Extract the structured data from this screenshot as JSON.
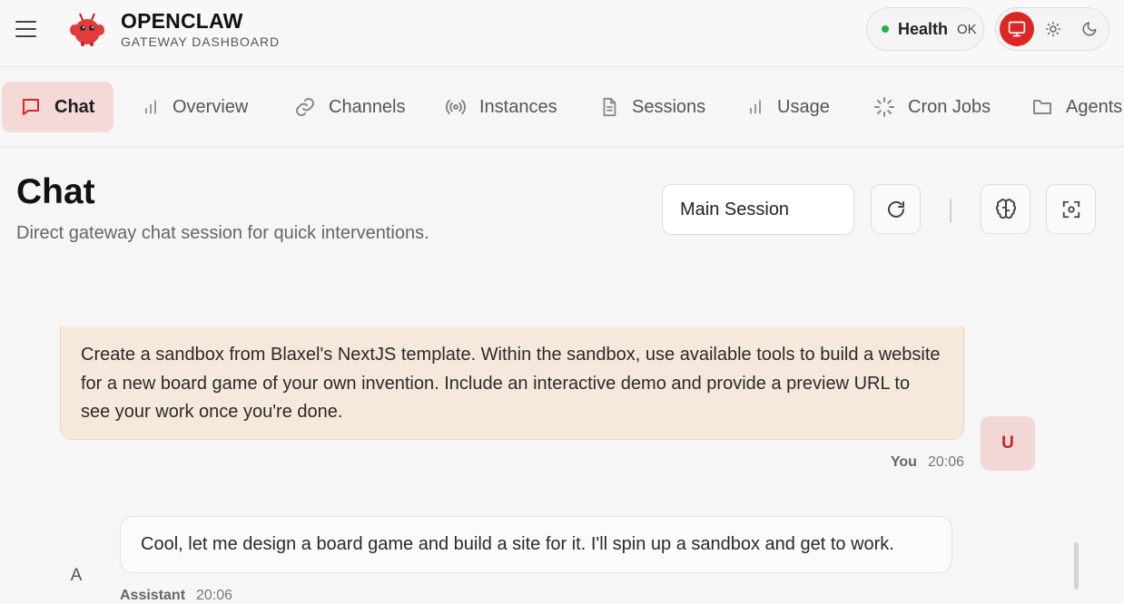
{
  "header": {
    "brand_title": "OPENCLAW",
    "brand_subtitle": "GATEWAY DASHBOARD",
    "health": {
      "label": "Health",
      "value": "OK",
      "status_color": "#22b14c"
    },
    "theme_options": [
      "monitor-icon",
      "sun-icon",
      "moon-icon"
    ],
    "theme_selected": "monitor-icon",
    "accent_color": "#dc2626"
  },
  "tabs": [
    {
      "label": "Chat",
      "icon": "chat-icon",
      "active": true
    },
    {
      "label": "Overview",
      "icon": "bar-chart-icon",
      "active": false
    },
    {
      "label": "Channels",
      "icon": "link-icon",
      "active": false
    },
    {
      "label": "Instances",
      "icon": "broadcast-icon",
      "active": false
    },
    {
      "label": "Sessions",
      "icon": "document-icon",
      "active": false
    },
    {
      "label": "Usage",
      "icon": "bar-chart-icon",
      "active": false
    },
    {
      "label": "Cron Jobs",
      "icon": "loader-icon",
      "active": false
    },
    {
      "label": "Agents",
      "icon": "folder-icon",
      "active": false
    }
  ],
  "page": {
    "title": "Chat",
    "subtitle": "Direct gateway chat session for quick interventions.",
    "session_select": "Main Session"
  },
  "messages": [
    {
      "role": "user",
      "text": "Create a sandbox from Blaxel's NextJS template. Within the sandbox, use available tools to build a website for a new board game of your own invention. Include an interactive demo and provide a preview URL to see your work once you're done.",
      "author": "You",
      "time": "20:06",
      "avatar": "U"
    },
    {
      "role": "assistant",
      "text": "Cool, let me design a board game and build a site for it. I'll spin up a sandbox and get to work.",
      "author": "Assistant",
      "time": "20:06",
      "avatar": "A"
    }
  ]
}
